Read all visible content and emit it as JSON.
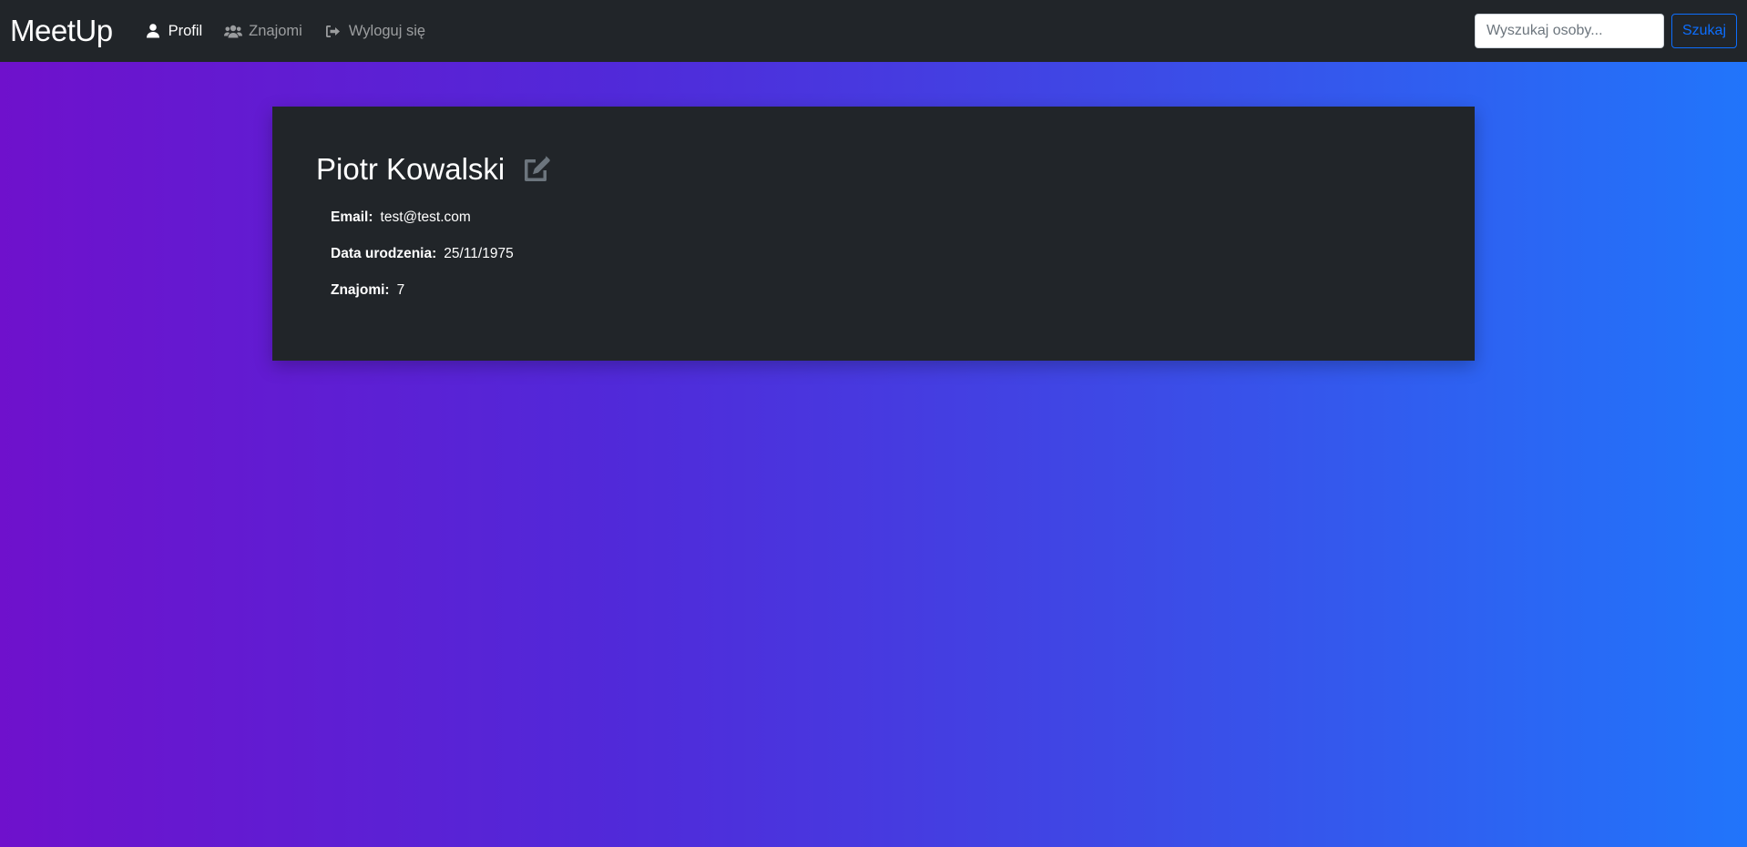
{
  "navbar": {
    "brand": "MeetUp",
    "links": [
      {
        "label": "Profil",
        "icon": "user-icon",
        "active": true
      },
      {
        "label": "Znajomi",
        "icon": "users-icon",
        "active": false
      },
      {
        "label": "Wyloguj się",
        "icon": "sign-out-icon",
        "active": false
      }
    ],
    "search": {
      "placeholder": "Wyszukaj osoby...",
      "value": "",
      "button_label": "Szukaj"
    }
  },
  "profile": {
    "name": "Piotr Kowalski",
    "edit_icon": "edit-icon",
    "details": [
      {
        "label": "Email:",
        "value": "test@test.com"
      },
      {
        "label": "Data urodzenia:",
        "value": "25/11/1975"
      },
      {
        "label": "Znajomi:",
        "value": "7"
      }
    ]
  },
  "colors": {
    "navbar_bg": "#212529",
    "card_bg": "#212529",
    "gradient_start": "#6f11cc",
    "gradient_end": "#2175fb",
    "button_accent": "#0d6efd"
  }
}
